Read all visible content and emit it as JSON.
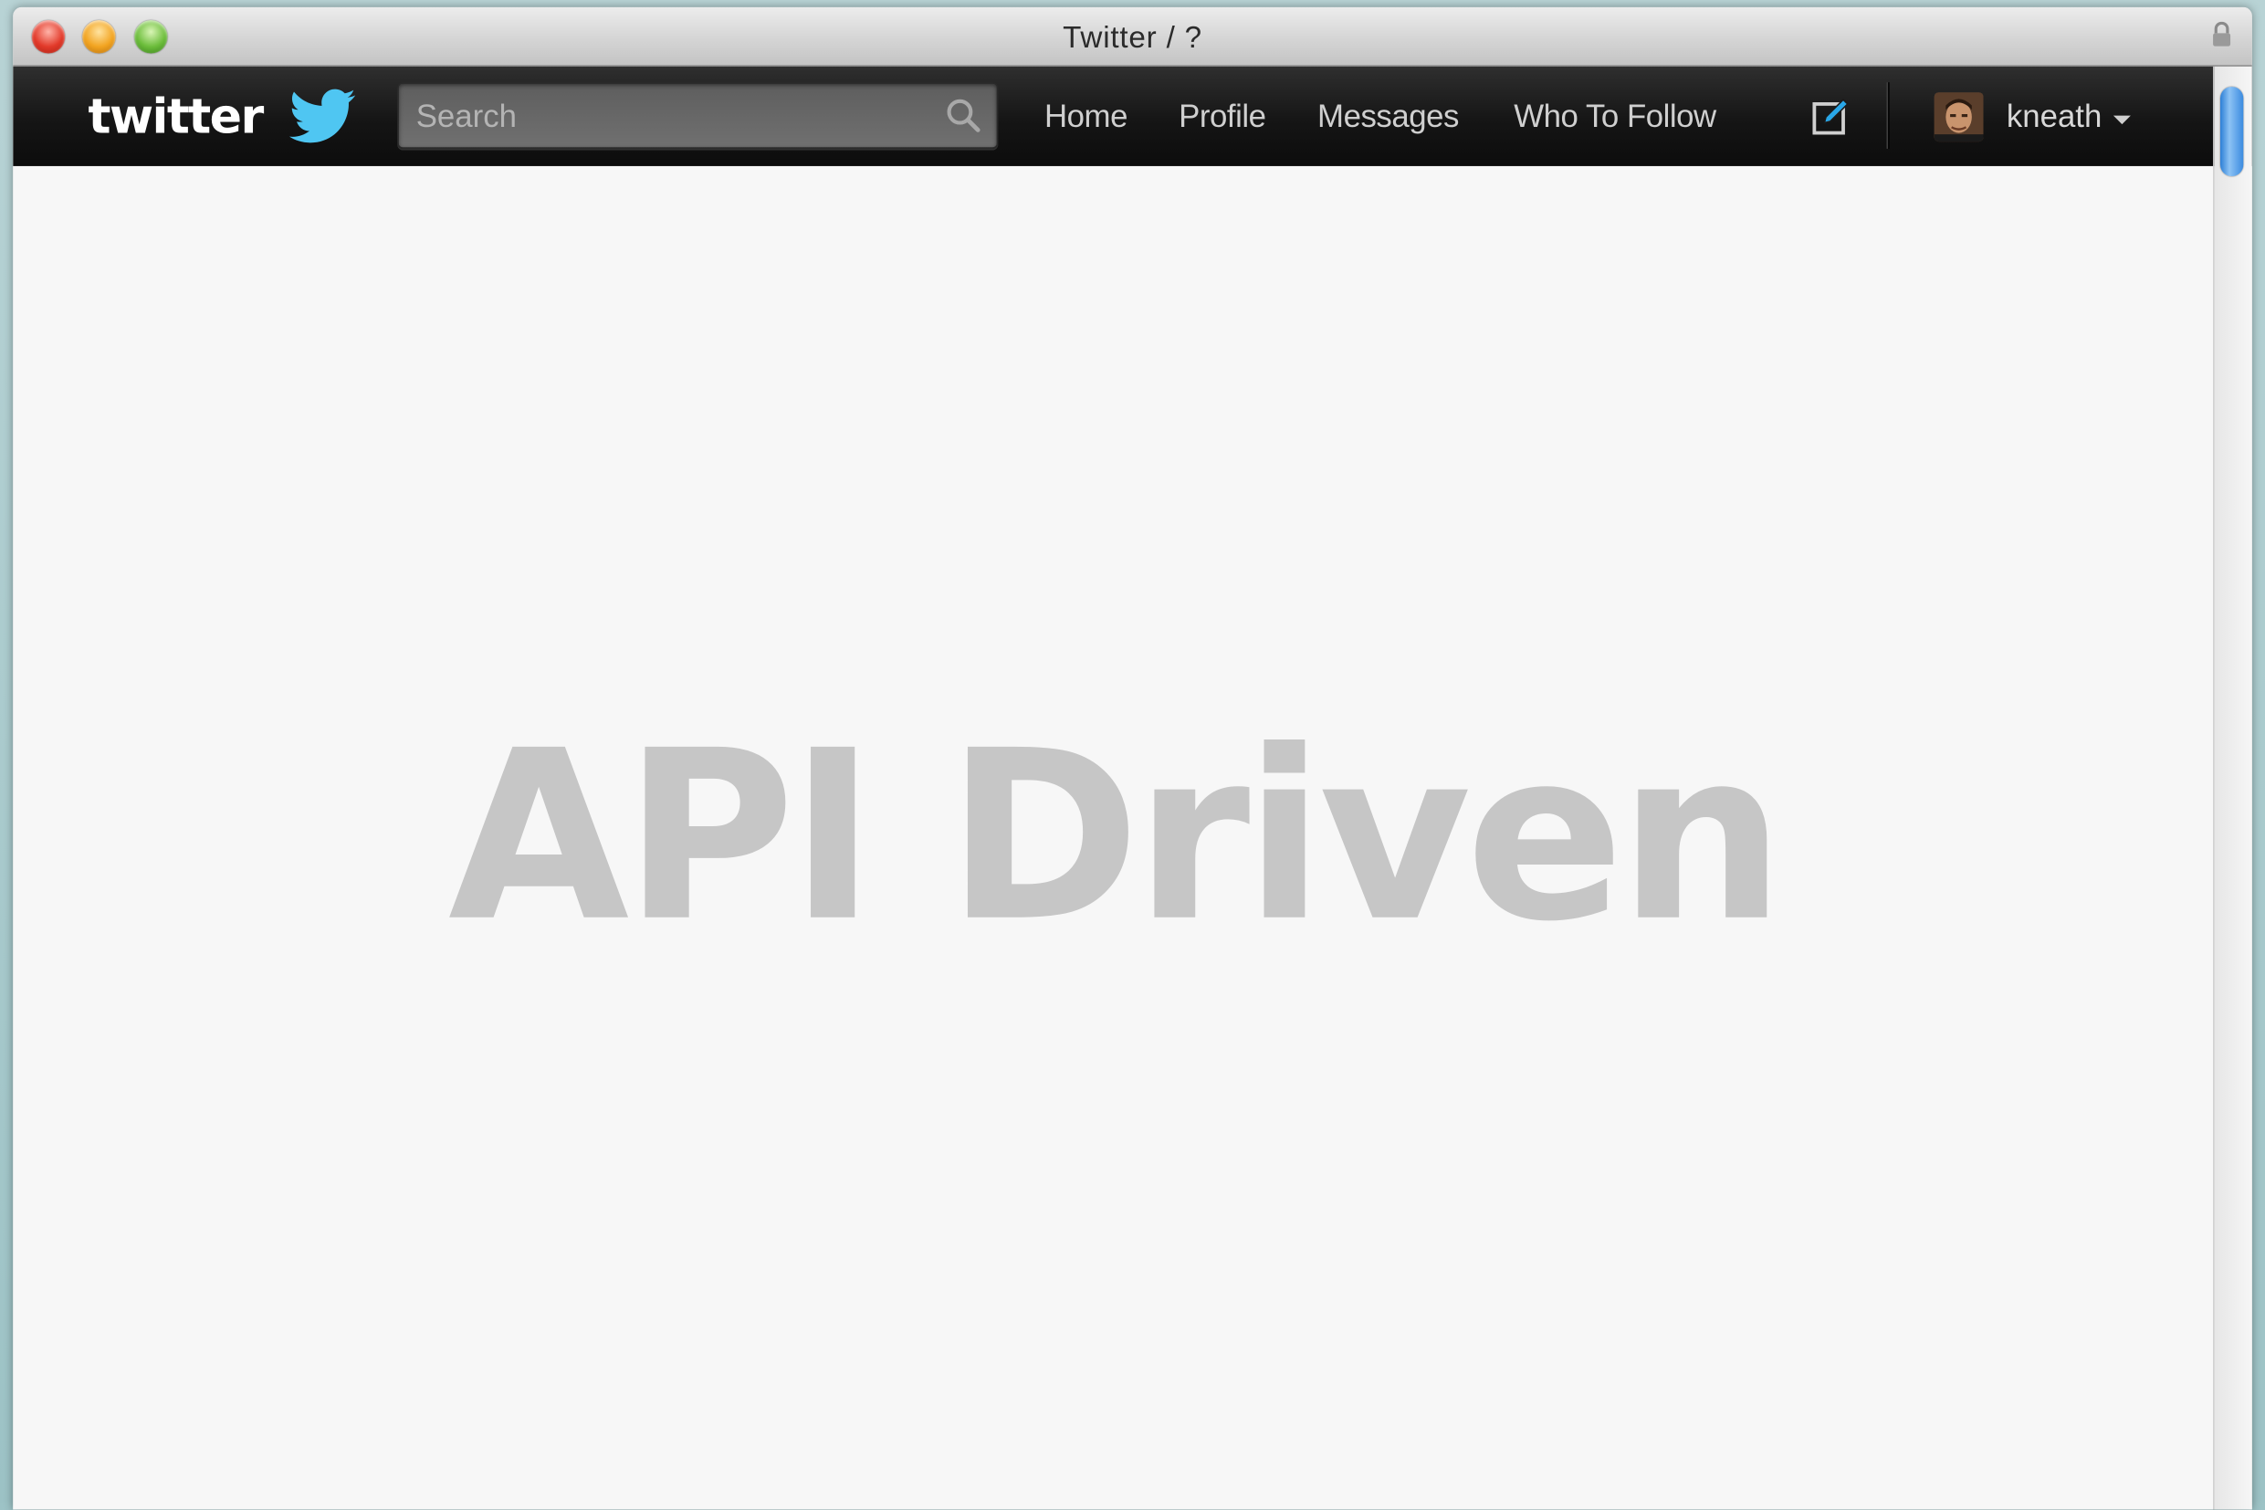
{
  "window": {
    "title": "Twitter / ?"
  },
  "navbar": {
    "logo_text": "twitter",
    "search": {
      "placeholder": "Search",
      "value": ""
    },
    "links": {
      "home": "Home",
      "profile": "Profile",
      "messages": "Messages",
      "who_to_follow": "Who To Follow"
    },
    "account": {
      "username": "kneath"
    },
    "icons": [
      "twitter-bird-icon",
      "search-icon",
      "compose-icon",
      "chevron-down-icon",
      "lock-icon"
    ]
  },
  "content": {
    "headline": "API Driven"
  },
  "colors": {
    "navbar_bg": "#151515",
    "brand_blue": "#33ccff",
    "headline_gray": "#c6c6c6",
    "page_bg": "#f7f7f7"
  }
}
